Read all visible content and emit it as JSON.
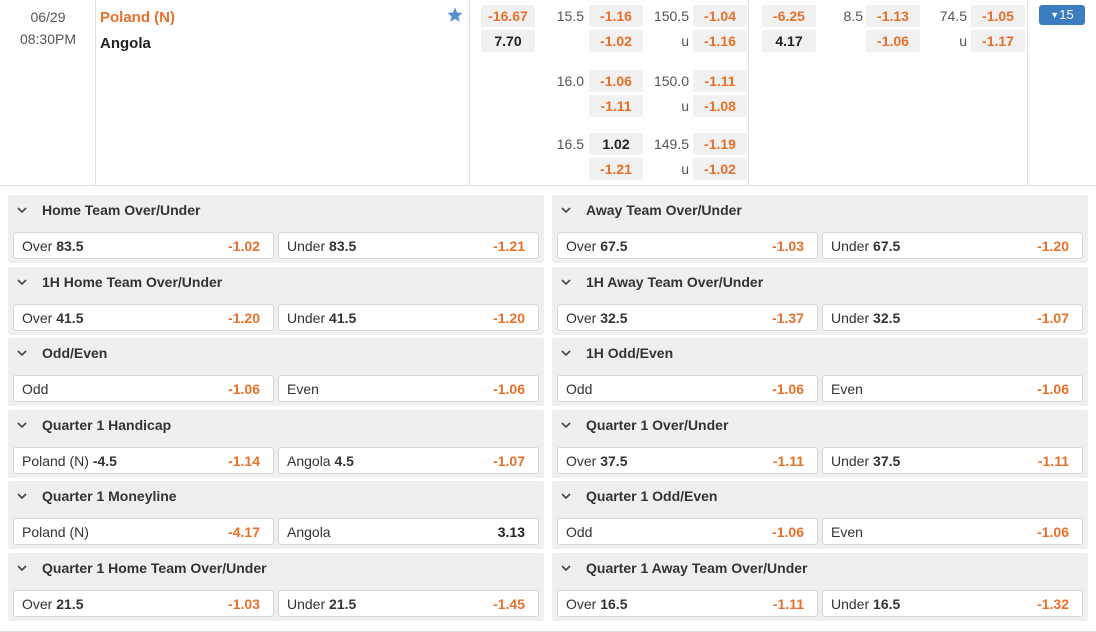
{
  "match": {
    "date": "06/29",
    "time": "08:30PM",
    "home_team": "Poland (N)",
    "away_team": "Angola",
    "more_count": "15",
    "full_time": {
      "moneyline": [
        "-16.67",
        "7.70"
      ],
      "lines": [
        {
          "handicap": "15.5",
          "hc_odds": [
            "-1.16",
            "-1.02"
          ],
          "total": "150.5",
          "under_label": "u",
          "total_odds": [
            "-1.04",
            "-1.16"
          ]
        },
        {
          "handicap": "16.0",
          "hc_odds": [
            "-1.06",
            "-1.11"
          ],
          "total": "150.0",
          "under_label": "u",
          "total_odds": [
            "-1.11",
            "-1.08"
          ]
        },
        {
          "handicap": "16.5",
          "hc_odds": [
            "1.02",
            "-1.21"
          ],
          "total": "149.5",
          "under_label": "u",
          "total_odds": [
            "-1.19",
            "-1.02"
          ]
        }
      ]
    },
    "first_half": {
      "moneyline": [
        "-6.25",
        "4.17"
      ],
      "handicap": "8.5",
      "hc_odds": [
        "-1.13",
        "-1.06"
      ],
      "total": "74.5",
      "under_label": "u",
      "total_odds": [
        "-1.05",
        "-1.17"
      ]
    }
  },
  "markets": [
    {
      "title": "Home Team Over/Under",
      "options": [
        {
          "label": "Over",
          "line": "83.5",
          "odds": "-1.02"
        },
        {
          "label": "Under",
          "line": "83.5",
          "odds": "-1.21"
        }
      ]
    },
    {
      "title": "Away Team Over/Under",
      "options": [
        {
          "label": "Over",
          "line": "67.5",
          "odds": "-1.03"
        },
        {
          "label": "Under",
          "line": "67.5",
          "odds": "-1.20"
        }
      ]
    },
    {
      "title": "1H Home Team Over/Under",
      "options": [
        {
          "label": "Over",
          "line": "41.5",
          "odds": "-1.20"
        },
        {
          "label": "Under",
          "line": "41.5",
          "odds": "-1.20"
        }
      ]
    },
    {
      "title": "1H Away Team Over/Under",
      "options": [
        {
          "label": "Over",
          "line": "32.5",
          "odds": "-1.37"
        },
        {
          "label": "Under",
          "line": "32.5",
          "odds": "-1.07"
        }
      ]
    },
    {
      "title": "Odd/Even",
      "options": [
        {
          "label": "Odd",
          "line": "",
          "odds": "-1.06"
        },
        {
          "label": "Even",
          "line": "",
          "odds": "-1.06"
        }
      ]
    },
    {
      "title": "1H Odd/Even",
      "options": [
        {
          "label": "Odd",
          "line": "",
          "odds": "-1.06"
        },
        {
          "label": "Even",
          "line": "",
          "odds": "-1.06"
        }
      ]
    },
    {
      "title": "Quarter 1 Handicap",
      "options": [
        {
          "label": "Poland (N)",
          "line": "-4.5",
          "odds": "-1.14"
        },
        {
          "label": "Angola",
          "line": "4.5",
          "odds": "-1.07"
        }
      ]
    },
    {
      "title": "Quarter 1 Over/Under",
      "options": [
        {
          "label": "Over",
          "line": "37.5",
          "odds": "-1.11"
        },
        {
          "label": "Under",
          "line": "37.5",
          "odds": "-1.11"
        }
      ]
    },
    {
      "title": "Quarter 1 Moneyline",
      "options": [
        {
          "label": "Poland (N)",
          "line": "",
          "odds": "-4.17"
        },
        {
          "label": "Angola",
          "line": "",
          "odds": "3.13"
        }
      ]
    },
    {
      "title": "Quarter 1 Odd/Even",
      "options": [
        {
          "label": "Odd",
          "line": "",
          "odds": "-1.06"
        },
        {
          "label": "Even",
          "line": "",
          "odds": "-1.06"
        }
      ]
    },
    {
      "title": "Quarter 1 Home Team Over/Under",
      "options": [
        {
          "label": "Over",
          "line": "21.5",
          "odds": "-1.03"
        },
        {
          "label": "Under",
          "line": "21.5",
          "odds": "-1.45"
        }
      ]
    },
    {
      "title": "Quarter 1 Away Team Over/Under",
      "options": [
        {
          "label": "Over",
          "line": "16.5",
          "odds": "-1.11"
        },
        {
          "label": "Under",
          "line": "16.5",
          "odds": "-1.32"
        }
      ]
    }
  ],
  "colors": {
    "negative_odds": "#e8702a",
    "positive_odds": "#222222",
    "more_button": "#3c7cc0",
    "star": "#3c7cc0"
  },
  "icons": {
    "favorite": "star-icon",
    "expand": "chevron-down-icon",
    "more": "triangle-down-icon"
  }
}
